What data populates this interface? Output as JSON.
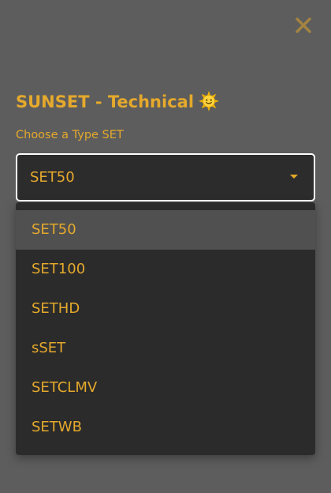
{
  "colors": {
    "accent": "#e5a92c",
    "page_background": "#5d5d5d",
    "surface": "#2c2c2c",
    "selected_row": "#505050",
    "select_border": "#ffffff"
  },
  "close_icon": "close-x-icon",
  "dialog": {
    "title": "SUNSET - Technical",
    "title_icon": "sun-face-emoji-icon",
    "select_label": "Choose a Type SET",
    "selected_value": "SET50",
    "caret_icon": "caret-down-icon"
  },
  "menu": {
    "options": [
      {
        "label": "SET50",
        "selected": true
      },
      {
        "label": "SET100",
        "selected": false
      },
      {
        "label": "SETHD",
        "selected": false
      },
      {
        "label": "sSET",
        "selected": false
      },
      {
        "label": "SETCLMV",
        "selected": false
      },
      {
        "label": "SETWB",
        "selected": false
      }
    ]
  }
}
